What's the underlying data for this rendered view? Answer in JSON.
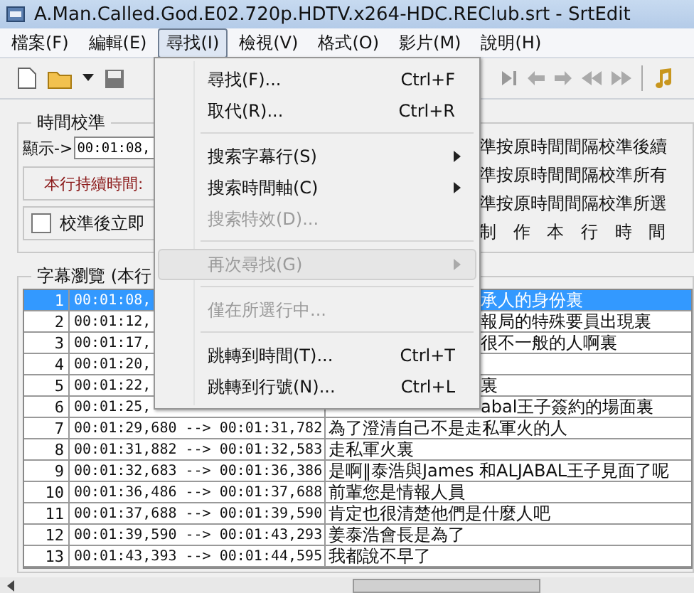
{
  "window": {
    "title": "A.Man.Called.God.E02.720p.HDTV.x264-HDC.REClub.srt - SrtEdit"
  },
  "menu_bar": [
    {
      "label": "檔案(F)",
      "selected": false
    },
    {
      "label": "編輯(E)",
      "selected": false
    },
    {
      "label": "尋找(I)",
      "selected": true
    },
    {
      "label": "檢視(V)",
      "selected": false
    },
    {
      "label": "格式(O)",
      "selected": false
    },
    {
      "label": "影片(M)",
      "selected": false
    },
    {
      "label": "說明(H)",
      "selected": false
    }
  ],
  "time_calibration": {
    "title": "時間校準",
    "display_label": "顯示->",
    "display_value": "00:01:08,",
    "duration_label": "本行持續時間:",
    "save_checkbox": {
      "label": "校準後立即",
      "checked": false
    },
    "buttons": [
      {
        "label": "準按原時間間隔校準後續"
      },
      {
        "label": "準按原時間間隔校準所有"
      },
      {
        "label": "準按原時間間隔校準所選"
      },
      {
        "label": "制 作 本 行 時 間"
      }
    ]
  },
  "subtitle_browser": {
    "title": "字幕瀏覽 (本行",
    "rows": [
      {
        "index": "1",
        "time": "00:01:08,",
        "text": "承人的身份裏",
        "selected": true,
        "covered": true
      },
      {
        "index": "2",
        "time": "00:01:12,",
        "text": "報局的特殊要員出現裏",
        "selected": false,
        "covered": true
      },
      {
        "index": "3",
        "time": "00:01:17,",
        "text": "很不一般的人啊裏",
        "selected": false,
        "covered": true
      },
      {
        "index": "4",
        "time": "00:01:20,",
        "selected": false
      },
      {
        "index": "5",
        "time": "00:01:22,",
        "text": "裏",
        "selected": false,
        "covered": true
      },
      {
        "index": "6",
        "time": "00:01:25,",
        "text": "abal王子簽約的場面裏",
        "selected": false,
        "covered": true
      },
      {
        "index": "7",
        "time": "00:01:29,680 --> 00:01:31,782",
        "text": "為了澄清自己不是走私軍火的人",
        "selected": false,
        "covered": false
      },
      {
        "index": "8",
        "time": "00:01:31,882 --> 00:01:32,583",
        "text": "走私軍火裏",
        "selected": false,
        "covered": false
      },
      {
        "index": "9",
        "time": "00:01:32,683 --> 00:01:36,386",
        "text": "是啊‖泰浩與James 和ALJABAL王子見面了呢",
        "selected": false,
        "covered": false
      },
      {
        "index": "10",
        "time": "00:01:36,486 --> 00:01:37,688",
        "text": "前輩您是情報人員",
        "selected": false,
        "covered": false
      },
      {
        "index": "11",
        "time": "00:01:37,688 --> 00:01:39,590",
        "text": "肯定也很清楚他們是什麼人吧",
        "selected": false,
        "covered": false
      },
      {
        "index": "12",
        "time": "00:01:39,590 --> 00:01:43,293",
        "text": "姜泰浩會長是為了",
        "selected": false,
        "covered": false
      },
      {
        "index": "13",
        "time": "00:01:43,393 --> 00:01:44,595",
        "text": "我都說不早了",
        "selected": false,
        "covered": false
      }
    ]
  },
  "search_menu": [
    {
      "kind": "item",
      "label": "尋找(F)...",
      "shortcut": "Ctrl+F",
      "disabled": false,
      "highlighted": false
    },
    {
      "kind": "item",
      "label": "取代(R)...",
      "shortcut": "Ctrl+R",
      "disabled": false,
      "highlighted": false
    },
    {
      "kind": "separator"
    },
    {
      "kind": "submenu",
      "label": "搜索字幕行(S)",
      "disabled": false,
      "highlighted": false
    },
    {
      "kind": "submenu",
      "label": "搜索時間軸(C)",
      "disabled": false,
      "highlighted": false
    },
    {
      "kind": "item",
      "label": "搜索特效(D)...",
      "disabled": true,
      "highlighted": false
    },
    {
      "kind": "separator"
    },
    {
      "kind": "submenu",
      "label": "再次尋找(G)",
      "disabled": true,
      "highlighted": true
    },
    {
      "kind": "separator"
    },
    {
      "kind": "item",
      "label": "僅在所選行中...",
      "disabled": true,
      "highlighted": false
    },
    {
      "kind": "separator"
    },
    {
      "kind": "item",
      "label": "跳轉到時間(T)...",
      "shortcut": "Ctrl+T",
      "disabled": false,
      "highlighted": false
    },
    {
      "kind": "item",
      "label": "跳轉到行號(N)...",
      "shortcut": "Ctrl+L",
      "disabled": false,
      "highlighted": false
    }
  ]
}
